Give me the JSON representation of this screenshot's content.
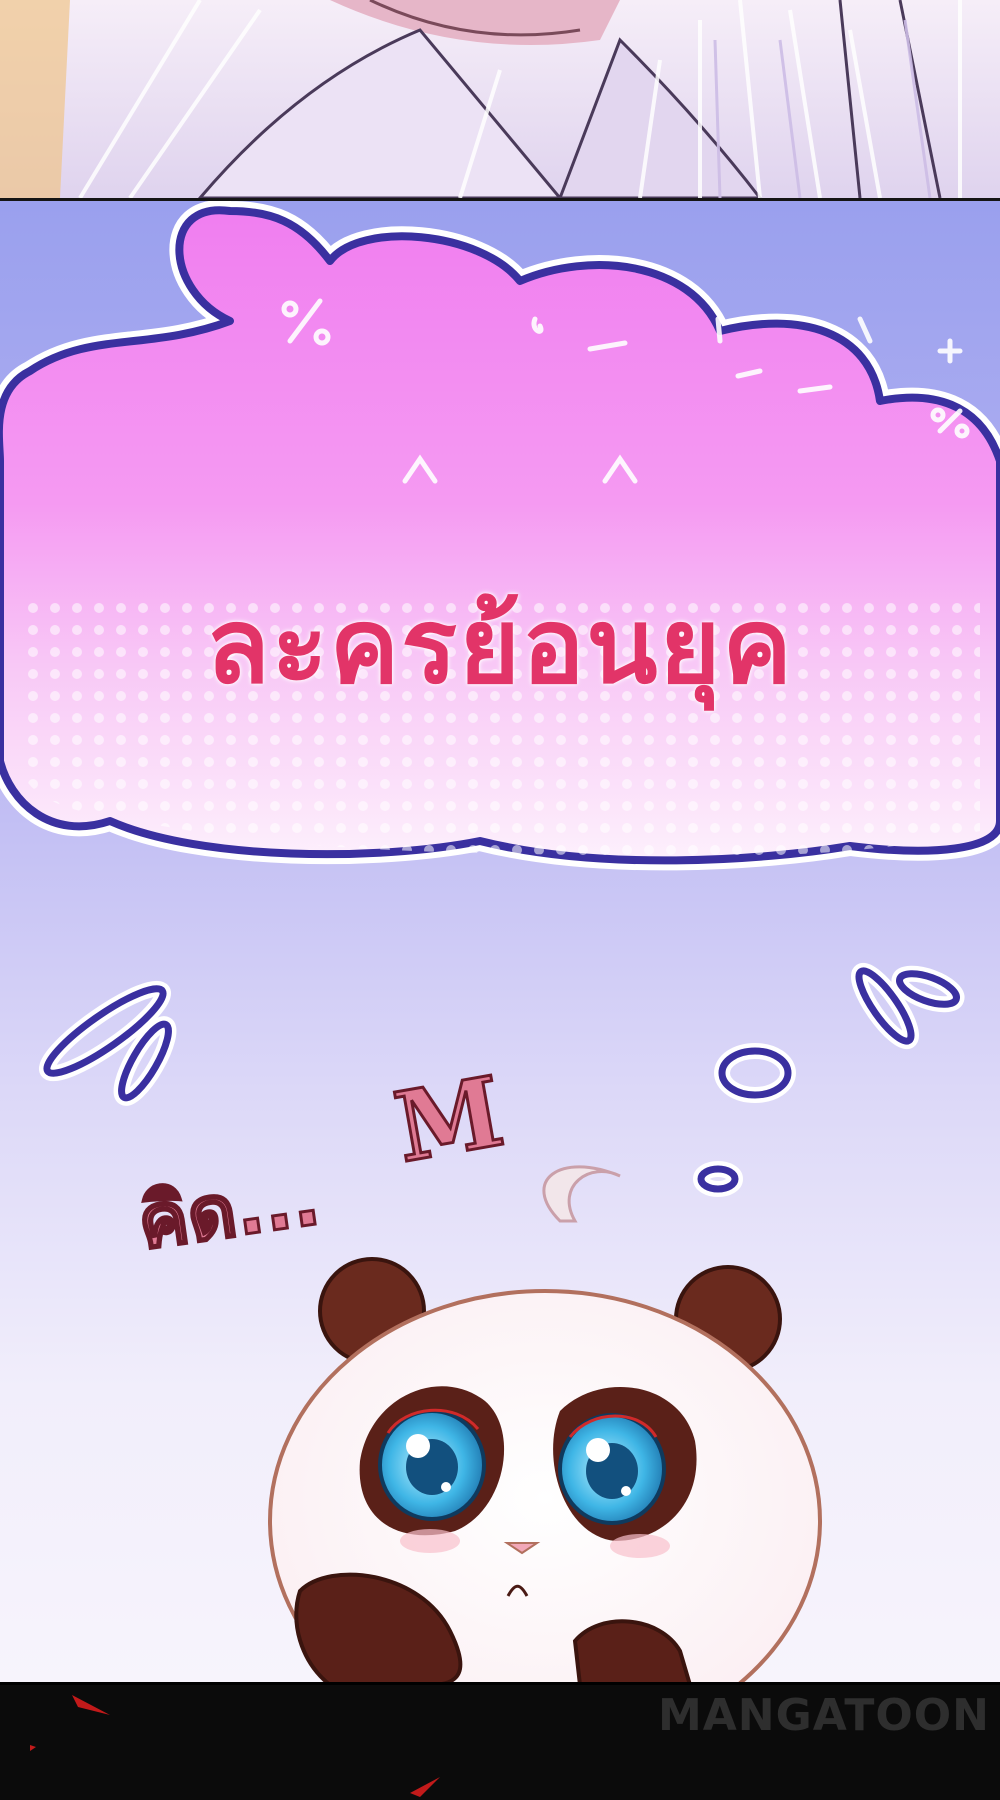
{
  "bubble": {
    "text": "ละครย้อนยุค",
    "fill_color": "#f48ef0",
    "outline_color": "#3a30a0",
    "doodles": [
      "%",
      "^",
      "^",
      "%",
      "-",
      "+"
    ]
  },
  "thought": {
    "text": "คิด...",
    "sfx": "M"
  },
  "character": {
    "icon": "panda-icon",
    "eye_color": "#3fb6e6"
  },
  "watermark": {
    "text": "MANGATOON"
  },
  "colors": {
    "background_top": "#9aa0ee",
    "background_bottom": "#f7f4fc",
    "title_text": "#e23468",
    "thought_text": "#e07a94"
  }
}
